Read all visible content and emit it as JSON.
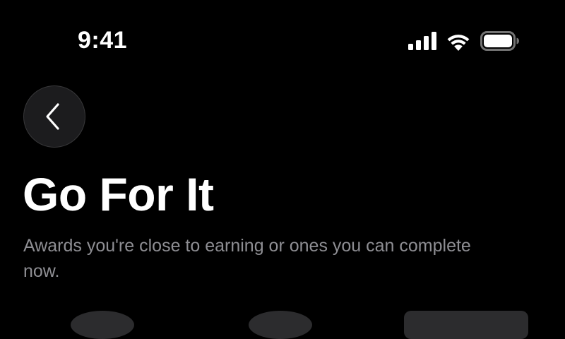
{
  "status_bar": {
    "time": "9:41",
    "icons": [
      "cellular-signal-icon",
      "wifi-icon",
      "battery-icon"
    ]
  },
  "navigation": {
    "back_icon": "chevron-left-icon"
  },
  "header": {
    "title": "Go For It",
    "subtitle": "Awards you're close to earning or ones you can complete now."
  },
  "colors": {
    "background": "#000000",
    "text_primary": "#ffffff",
    "text_secondary": "#8e8e93",
    "button_fill": "#1c1c1e"
  }
}
